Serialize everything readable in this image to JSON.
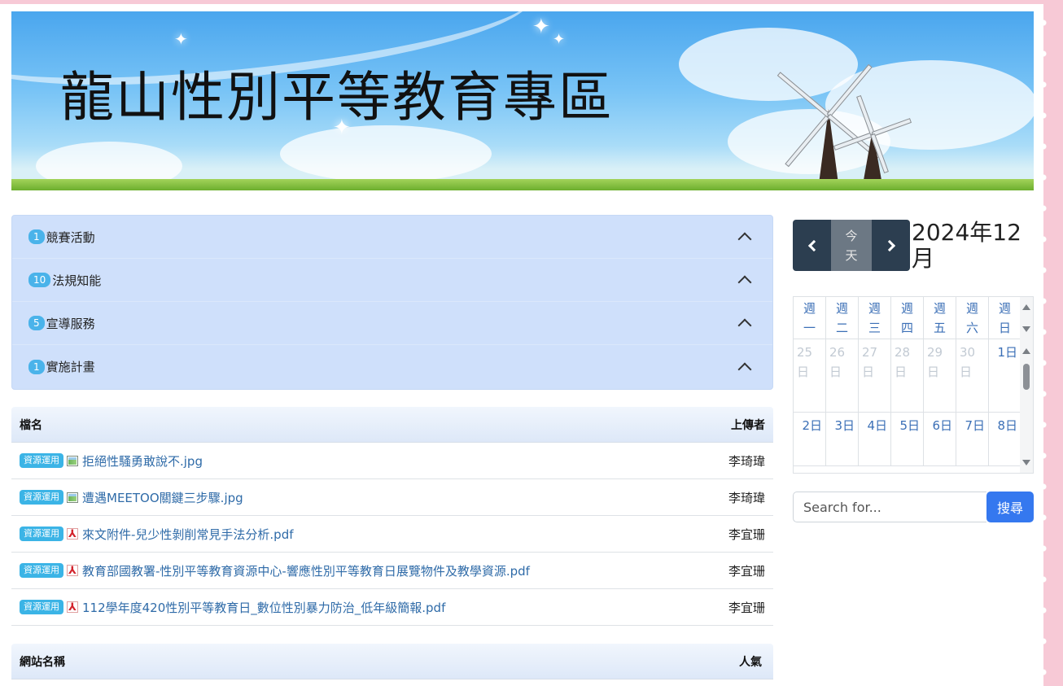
{
  "banner": {
    "title": "龍山性別平等教育專區"
  },
  "accordion": {
    "items": [
      {
        "count": "1",
        "label": "競賽活動"
      },
      {
        "count": "10",
        "label": "法規知能"
      },
      {
        "count": "5",
        "label": "宣導服務"
      },
      {
        "count": "1",
        "label": "實施計畫"
      }
    ]
  },
  "files": {
    "header_name": "檔名",
    "header_uploader": "上傳者",
    "rows": [
      {
        "tag": "資源運用",
        "icon": "image-file-icon",
        "name": "拒絕性騷勇敢說不.jpg",
        "uploader": "李琦瑋"
      },
      {
        "tag": "資源運用",
        "icon": "image-file-icon",
        "name": "遭遇MEETOO關鍵三步驟.jpg",
        "uploader": "李琦瑋"
      },
      {
        "tag": "資源運用",
        "icon": "pdf-file-icon",
        "name": "來文附件-兒少性剝削常見手法分析.pdf",
        "uploader": "李宜珊"
      },
      {
        "tag": "資源運用",
        "icon": "pdf-file-icon",
        "name": "教育部國教署-性別平等教育資源中心-響應性別平等教育日展覽物件及教學資源.pdf",
        "uploader": "李宜珊"
      },
      {
        "tag": "資源運用",
        "icon": "pdf-file-icon",
        "name": "112學年度420性別平等教育日_數位性別暴力防治_低年級簡報.pdf",
        "uploader": "李宜珊"
      }
    ]
  },
  "sites": {
    "header_name": "網站名稱",
    "header_popularity": "人氣"
  },
  "calendar": {
    "prev_icon": "chevron-left-icon",
    "next_icon": "chevron-right-icon",
    "today_line1": "今",
    "today_line2": "天",
    "title": "2024年12月",
    "weekdays": [
      {
        "l1": "週",
        "l2": "一"
      },
      {
        "l1": "週",
        "l2": "二"
      },
      {
        "l1": "週",
        "l2": "三"
      },
      {
        "l1": "週",
        "l2": "四"
      },
      {
        "l1": "週",
        "l2": "五"
      },
      {
        "l1": "週",
        "l2": "六"
      },
      {
        "l1": "週",
        "l2": "日"
      }
    ],
    "week1": [
      {
        "d": "25",
        "u": "日",
        "other": true
      },
      {
        "d": "26",
        "u": "日",
        "other": true
      },
      {
        "d": "27",
        "u": "日",
        "other": true
      },
      {
        "d": "28",
        "u": "日",
        "other": true
      },
      {
        "d": "29",
        "u": "日",
        "other": true
      },
      {
        "d": "30",
        "u": "日",
        "other": true
      },
      {
        "d": "1日",
        "u": "",
        "other": false
      }
    ],
    "week2": [
      "2日",
      "3日",
      "4日",
      "5日",
      "6日",
      "7日",
      "8日"
    ]
  },
  "search": {
    "placeholder": "Search for...",
    "button_label": "搜尋"
  },
  "colors": {
    "accordion_bg": "#cfe0fb",
    "badge": "#4ab3ea",
    "link": "#2f6ba8",
    "calendar_button": "#2c3e50",
    "search_button": "#3578ef",
    "page_background": "#f7c9d6"
  }
}
